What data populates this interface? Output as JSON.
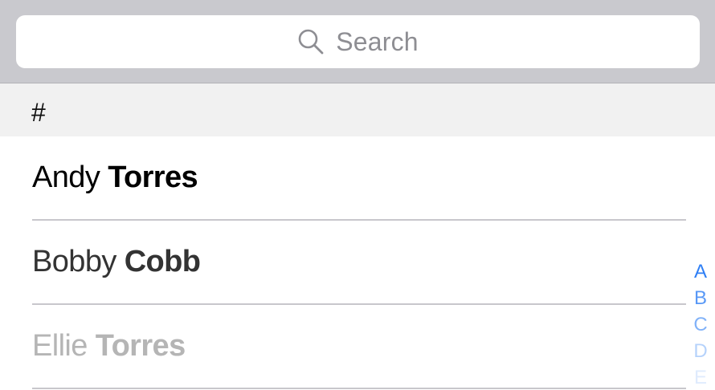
{
  "search": {
    "placeholder": "Search",
    "icon": "magnifying-glass-icon"
  },
  "section": {
    "header": "#"
  },
  "contacts": [
    {
      "first": "Andy",
      "last": "Torres",
      "color": "#000000"
    },
    {
      "first": "Bobby",
      "last": "Cobb",
      "color": "#333333"
    },
    {
      "first": "Ellie",
      "last": "Torres",
      "color": "#b5b5b5"
    }
  ],
  "index_letters": [
    "A",
    "B",
    "C",
    "D",
    "E"
  ],
  "colors": {
    "search_bar_bg": "#c9c9ce",
    "section_bg": "#f1f1f1",
    "index_accent": "#2f7ff5",
    "separator": "#c8c7cc"
  }
}
